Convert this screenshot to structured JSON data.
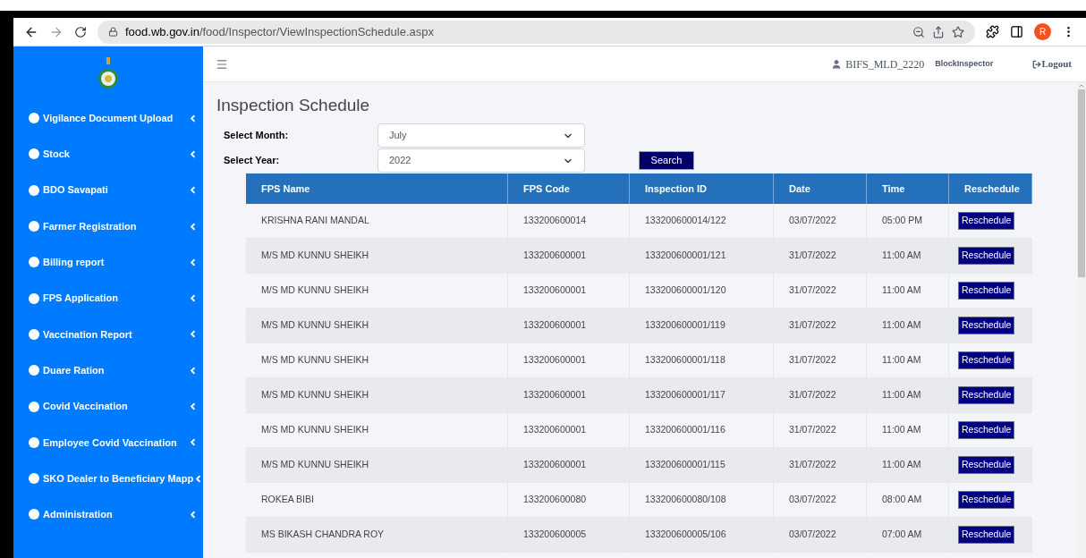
{
  "browser": {
    "url_host": "food.wb.gov.in",
    "url_path": "/food/Inspector/ViewInspectionSchedule.aspx",
    "profile_initial": "R"
  },
  "sidebar": {
    "items": [
      {
        "label": "Vigilance Document Upload",
        "expandable": true
      },
      {
        "label": "Stock",
        "expandable": true
      },
      {
        "label": "BDO Savapati",
        "expandable": true
      },
      {
        "label": "Farmer Registration",
        "expandable": true
      },
      {
        "label": "Billing report",
        "expandable": true
      },
      {
        "label": "FPS Application",
        "expandable": true
      },
      {
        "label": "Vaccination Report",
        "expandable": true
      },
      {
        "label": "Duare Ration",
        "expandable": true
      },
      {
        "label": "Covid Vaccination",
        "expandable": true
      },
      {
        "label": "Employee Covid Vaccination",
        "expandable": true
      },
      {
        "label": "SKO Dealer to Beneficiary Mapp",
        "expandable": true
      },
      {
        "label": "Administration",
        "expandable": true
      }
    ]
  },
  "header": {
    "username": "BIFS_MLD_2220",
    "role": "BlockInspector",
    "logout": "Logout"
  },
  "page": {
    "title": "Inspection Schedule",
    "filters": [
      {
        "label": "Select Month:",
        "value": "July"
      },
      {
        "label": "Select Year:",
        "value": "2022"
      }
    ],
    "search_button": "Search"
  },
  "table": {
    "columns": [
      "FPS Name",
      "FPS Code",
      "Inspection ID",
      "Date",
      "Time",
      "Reschedule"
    ],
    "rows": [
      {
        "fps_name": "KRISHNA RANI MANDAL",
        "fps_code": "133200600014",
        "inspection_id": "133200600014/122",
        "date": "03/07/2022",
        "time": "05:00 PM",
        "action": "Reschedule"
      },
      {
        "fps_name": "M/S MD KUNNU SHEIKH",
        "fps_code": "133200600001",
        "inspection_id": "133200600001/121",
        "date": "31/07/2022",
        "time": "11:00 AM",
        "action": "Reschedule"
      },
      {
        "fps_name": "M/S MD KUNNU SHEIKH",
        "fps_code": "133200600001",
        "inspection_id": "133200600001/120",
        "date": "31/07/2022",
        "time": "11:00 AM",
        "action": "Reschedule"
      },
      {
        "fps_name": "M/S MD KUNNU SHEIKH",
        "fps_code": "133200600001",
        "inspection_id": "133200600001/119",
        "date": "31/07/2022",
        "time": "11:00 AM",
        "action": "Reschedule"
      },
      {
        "fps_name": "M/S MD KUNNU SHEIKH",
        "fps_code": "133200600001",
        "inspection_id": "133200600001/118",
        "date": "31/07/2022",
        "time": "11:00 AM",
        "action": "Reschedule"
      },
      {
        "fps_name": "M/S MD KUNNU SHEIKH",
        "fps_code": "133200600001",
        "inspection_id": "133200600001/117",
        "date": "31/07/2022",
        "time": "11:00 AM",
        "action": "Reschedule"
      },
      {
        "fps_name": "M/S MD KUNNU SHEIKH",
        "fps_code": "133200600001",
        "inspection_id": "133200600001/116",
        "date": "31/07/2022",
        "time": "11:00 AM",
        "action": "Reschedule"
      },
      {
        "fps_name": "M/S MD KUNNU SHEIKH",
        "fps_code": "133200600001",
        "inspection_id": "133200600001/115",
        "date": "31/07/2022",
        "time": "11:00 AM",
        "action": "Reschedule"
      },
      {
        "fps_name": "ROKEA BIBI",
        "fps_code": "133200600080",
        "inspection_id": "133200600080/108",
        "date": "03/07/2022",
        "time": "08:00 AM",
        "action": "Reschedule"
      },
      {
        "fps_name": "MS BIKASH CHANDRA ROY",
        "fps_code": "133200600005",
        "inspection_id": "133200600005/106",
        "date": "03/07/2022",
        "time": "07:00 AM",
        "action": "Reschedule"
      }
    ]
  }
}
